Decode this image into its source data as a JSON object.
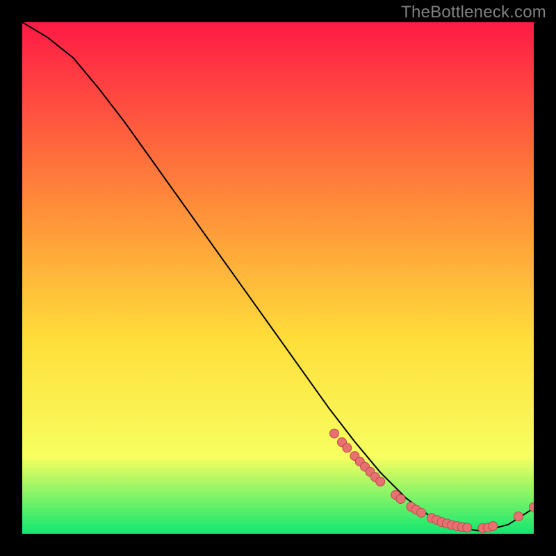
{
  "watermark": "TheBottleneck.com",
  "colors": {
    "gradient_top": "#ff1a45",
    "gradient_mid1": "#ff8a3a",
    "gradient_mid2": "#ffde3a",
    "gradient_mid3": "#f7ff60",
    "gradient_bottom": "#10e86f",
    "curve": "#000000",
    "dot_fill": "#e87070",
    "dot_stroke": "#b94c4c",
    "background": "#000000"
  },
  "chart_data": {
    "type": "line",
    "title": "",
    "xlabel": "",
    "ylabel": "",
    "xlim": [
      0,
      100
    ],
    "ylim": [
      0,
      100
    ],
    "series": [
      {
        "name": "curve",
        "x": [
          0,
          5,
          10,
          15,
          20,
          25,
          30,
          35,
          40,
          45,
          50,
          55,
          60,
          65,
          70,
          75,
          80,
          85,
          90,
          95,
          100
        ],
        "y": [
          100,
          97,
          93,
          87,
          80.5,
          73.5,
          66.5,
          59.5,
          52.5,
          45.5,
          38.5,
          31.5,
          24.5,
          18,
          12,
          7,
          3.2,
          1.2,
          0.5,
          1.8,
          5
        ]
      }
    ],
    "points": [
      {
        "x": 61,
        "y": 19.6
      },
      {
        "x": 62.5,
        "y": 17.9
      },
      {
        "x": 63.5,
        "y": 16.8
      },
      {
        "x": 65,
        "y": 15.2
      },
      {
        "x": 66,
        "y": 14.1
      },
      {
        "x": 67,
        "y": 13.1
      },
      {
        "x": 68,
        "y": 12.1
      },
      {
        "x": 69,
        "y": 11.1
      },
      {
        "x": 70,
        "y": 10.2
      },
      {
        "x": 73,
        "y": 7.6
      },
      {
        "x": 74,
        "y": 6.8
      },
      {
        "x": 76,
        "y": 5.3
      },
      {
        "x": 77,
        "y": 4.7
      },
      {
        "x": 78,
        "y": 4.1
      },
      {
        "x": 80,
        "y": 3.1
      },
      {
        "x": 81,
        "y": 2.7
      },
      {
        "x": 82,
        "y": 2.3
      },
      {
        "x": 83,
        "y": 2.0
      },
      {
        "x": 84,
        "y": 1.7
      },
      {
        "x": 85,
        "y": 1.5
      },
      {
        "x": 86,
        "y": 1.3
      },
      {
        "x": 87,
        "y": 1.2
      },
      {
        "x": 90,
        "y": 1.1
      },
      {
        "x": 91,
        "y": 1.2
      },
      {
        "x": 92,
        "y": 1.5
      },
      {
        "x": 97,
        "y": 3.4
      },
      {
        "x": 100,
        "y": 5.2
      }
    ]
  }
}
